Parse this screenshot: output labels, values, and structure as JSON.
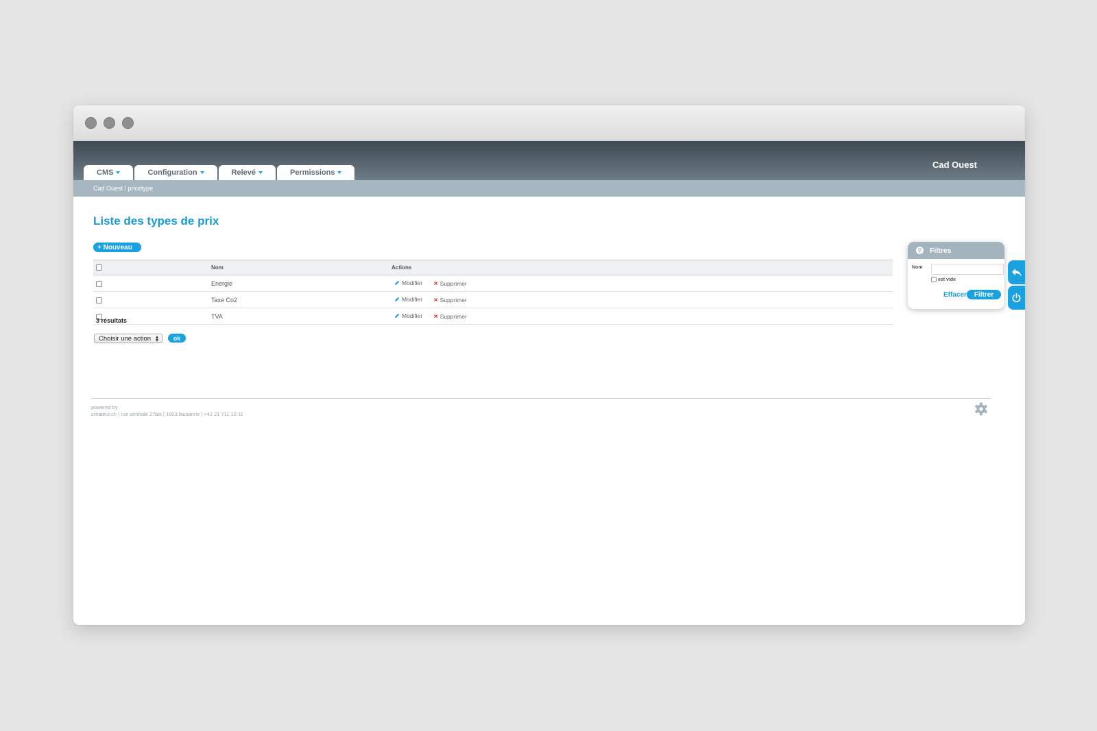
{
  "header": {
    "brand": "Cad Ouest",
    "tabs": [
      {
        "label": "CMS"
      },
      {
        "label": "Configuration"
      },
      {
        "label": "Relevé"
      },
      {
        "label": "Permissions"
      }
    ],
    "breadcrumb": "Cad Ouest / pricetype"
  },
  "main": {
    "title": "Liste des types de prix",
    "new_button": "+ Nouveau",
    "table": {
      "columns": [
        "Nom",
        "Actions"
      ],
      "rows": [
        {
          "name": "Energie",
          "edit": "Modifier",
          "delete": "Supprimer"
        },
        {
          "name": "Taxe Co2",
          "edit": "Modifier",
          "delete": "Supprimer"
        },
        {
          "name": "TVA",
          "edit": "Modifier",
          "delete": "Supprimer"
        }
      ]
    },
    "results": "3 résultats",
    "action_select": "Choisir une action",
    "ok_button": "ok"
  },
  "filters": {
    "title": "Filtres",
    "nom_label": "Nom",
    "nom_value": "",
    "empty_label": "est vide",
    "clear_button": "Effacer",
    "filter_button": "Filtrer"
  },
  "footer": {
    "powered": "powered by",
    "address": "createur.ch | rue centrale 27bis | 1003 lausanne | +41 21 711 10 11"
  },
  "icons": [
    "pencil-icon",
    "delete-x-icon",
    "search-icon",
    "back-arrow-icon",
    "power-icon",
    "gear-icon"
  ],
  "colors": {
    "accent": "#1aa1e0",
    "header_dark": "#3f4a52",
    "crumb_bar": "#a6b7c2",
    "delete_red": "#e0312a"
  }
}
